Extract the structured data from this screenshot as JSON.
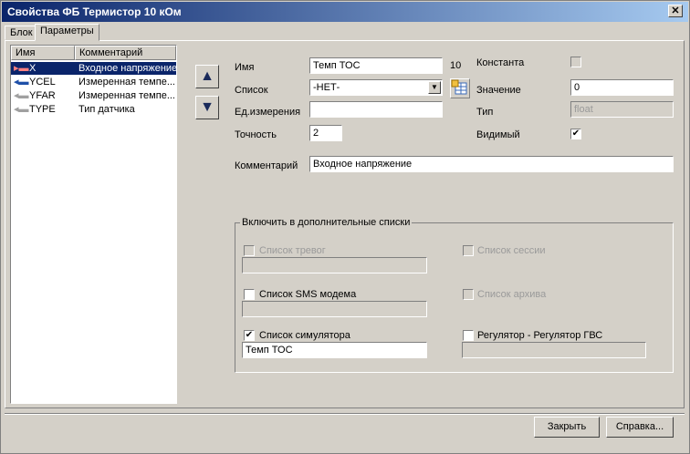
{
  "window": {
    "title": "Свойства ФБ Термистор 10 кОм",
    "close_symbol": "✕"
  },
  "tabs": [
    {
      "label": "Блок"
    },
    {
      "label": "Параметры"
    }
  ],
  "list": {
    "columns": [
      "Имя",
      "Комментарий"
    ],
    "rows": [
      {
        "icon": "input-arrow-icon",
        "name": "X",
        "comment": "Входное напряжение"
      },
      {
        "icon": "output-arrow-icon",
        "name": "YCEL",
        "comment": "Измеренная темпе..."
      },
      {
        "icon": "output-arrow-icon",
        "name": "YFAR",
        "comment": "Измеренная темпе..."
      },
      {
        "icon": "output-arrow-icon",
        "name": "TYPE",
        "comment": "Тип датчика"
      }
    ]
  },
  "nav": {
    "up_symbol": "▲",
    "down_symbol": "▼"
  },
  "form": {
    "name_label": "Имя",
    "name_value": "Темп ТОС",
    "name_count": "10",
    "list_label": "Список",
    "list_value": "-НЕТ-",
    "unit_label": "Ед.измерения",
    "unit_value": "",
    "precision_label": "Точность",
    "precision_value": "2",
    "comment_label": "Комментарий",
    "comment_value": "Входное напряжение",
    "const_label": "Константа",
    "const_checked": false,
    "value_label": "Значение",
    "value_value": "0",
    "type_label": "Тип",
    "type_value": "float",
    "visible_label": "Видимый",
    "visible_checked": true
  },
  "group": {
    "title": "Включить в дополнительные списки",
    "alarms_label": "Список тревог",
    "alarms_value": "",
    "session_label": "Список сессии",
    "sms_label": "Список SMS модема",
    "sms_value": "",
    "archive_label": "Список архива",
    "simulator_label": "Список симулятора",
    "simulator_value": "Темп ТОС",
    "regulator_label": "Регулятор - Регулятор ГВС",
    "regulator_value": "",
    "check_mark": "✔"
  },
  "buttons": {
    "close_label": "Закрыть",
    "help_label": "Справка..."
  },
  "colors": {
    "title_bar": "#0a246a",
    "selection": "#0a246a"
  }
}
